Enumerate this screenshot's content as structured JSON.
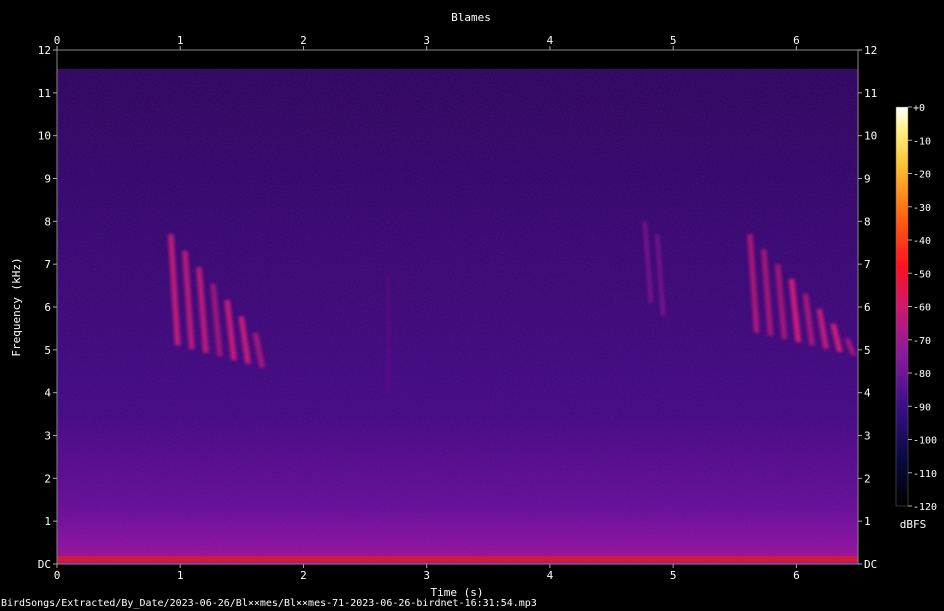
{
  "chart_data": {
    "type": "heatmap",
    "title": "Blames",
    "xlabel": "Time (s)",
    "ylabel": "Frequency (kHz)",
    "xlim": [
      0,
      6.5
    ],
    "ylim": [
      0,
      12
    ],
    "x_ticks": [
      "0",
      "1",
      "2",
      "3",
      "4",
      "5",
      "6"
    ],
    "y_ticks": [
      "DC",
      "1",
      "2",
      "3",
      "4",
      "5",
      "6",
      "7",
      "8",
      "9",
      "10",
      "11",
      "12"
    ],
    "colorbar": {
      "label": "dBFS",
      "range": [
        -120,
        0
      ],
      "ticks": [
        "+0",
        "-10",
        "-20",
        "-30",
        "-40",
        "-50",
        "-60",
        "-70",
        "-80",
        "-90",
        "-100",
        "-110",
        "-120"
      ]
    },
    "events": [
      {
        "t_start": 0.9,
        "t_end": 1.7,
        "f_low_khz": 4.5,
        "f_high_khz": 7.7,
        "level_dbfs": -70
      },
      {
        "t_start": 2.68,
        "t_end": 2.7,
        "f_low_khz": 4.0,
        "f_high_khz": 6.8,
        "level_dbfs": -85
      },
      {
        "t_start": 4.75,
        "t_end": 4.95,
        "f_low_khz": 5.5,
        "f_high_khz": 8.0,
        "level_dbfs": -85
      },
      {
        "t_start": 5.6,
        "t_end": 6.5,
        "f_low_khz": 4.8,
        "f_high_khz": 7.7,
        "level_dbfs": -70
      }
    ],
    "colors": {
      "low": "#000010",
      "mid": "#8a1a9e",
      "high": "#ff2000",
      "peak": "#ffffff"
    }
  },
  "footer": "BirdSongs/Extracted/By_Date/2023-06-26/Bl××mes/Bl××mes-71-2023-06-26-birdnet-16:31:54.mp3"
}
